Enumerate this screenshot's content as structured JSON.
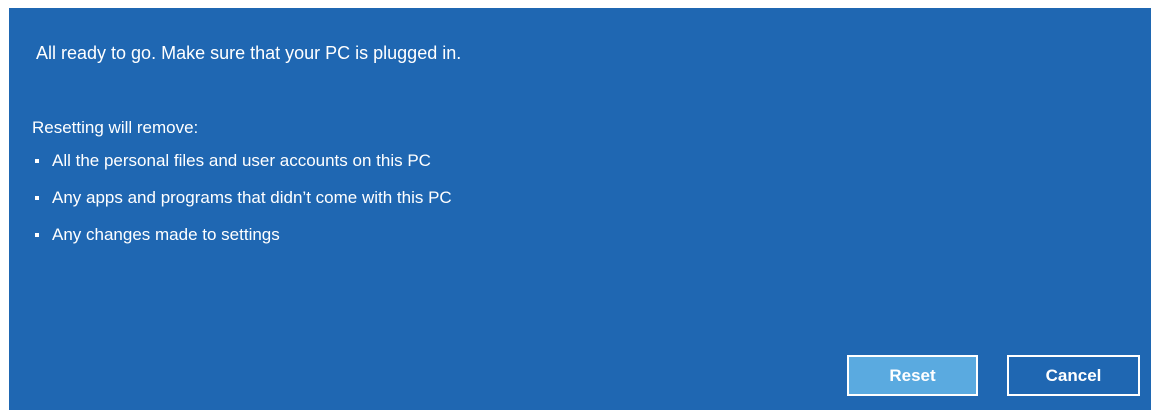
{
  "dialog": {
    "headline": "All ready to go. Make sure that your PC is plugged in.",
    "remove_label": "Resetting will remove:",
    "remove_items": [
      "All the personal files and user accounts on this PC",
      "Any apps and programs that didn’t come with this PC",
      "Any changes made to settings"
    ],
    "buttons": {
      "reset_label": "Reset",
      "cancel_label": "Cancel"
    }
  },
  "colors": {
    "background": "#1f67b2",
    "primary_button": "#5aaae0",
    "text": "#ffffff"
  }
}
